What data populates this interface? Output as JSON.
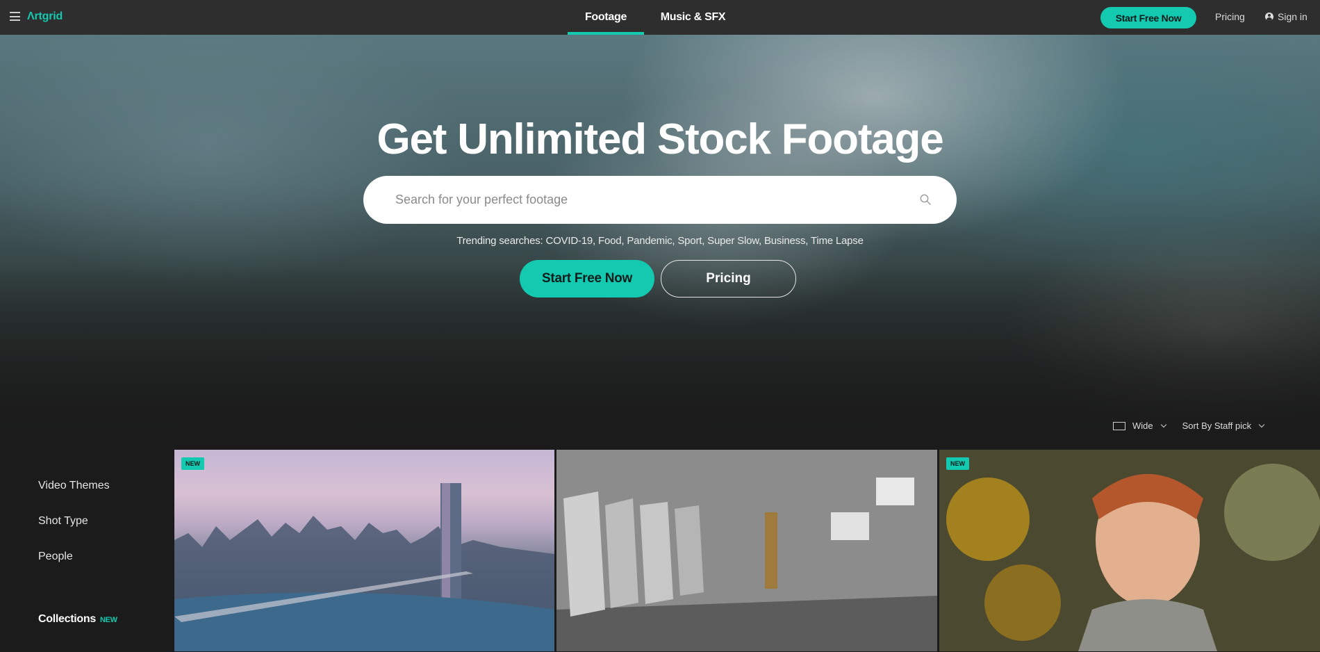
{
  "nav": {
    "logo": "Ʌrtgrid",
    "tabs": [
      {
        "label": "Footage",
        "active": true
      },
      {
        "label": "Music & SFX",
        "active": false
      }
    ],
    "cta": "Start Free Now",
    "pricing": "Pricing",
    "signin": "Sign in"
  },
  "hero": {
    "title": "Get Unlimited Stock Footage",
    "search_placeholder": "Search for your perfect footage",
    "trending_label": "Trending searches:",
    "trending": [
      "COVID-19",
      "Food",
      "Pandemic",
      "Sport",
      "Super Slow",
      "Business",
      "Time Lapse"
    ],
    "cta": "Start Free Now",
    "pricing": "Pricing"
  },
  "view": {
    "layout": "Wide",
    "sort": "Sort By Staff pick"
  },
  "sidebar": {
    "items": [
      "Video Themes",
      "Shot Type",
      "People"
    ],
    "collections": "Collections",
    "collections_badge": "NEW"
  },
  "thumbnails": [
    {
      "badge": "NEW",
      "subject": "city-skyline"
    },
    {
      "badge": "",
      "subject": "protest-riot-police"
    },
    {
      "badge": "NEW",
      "subject": "woman-in-flowers"
    }
  ],
  "colors": {
    "accent": "#13c9b0",
    "nav_bg": "#2e2e2e",
    "page_bg": "#1b1b1b"
  }
}
